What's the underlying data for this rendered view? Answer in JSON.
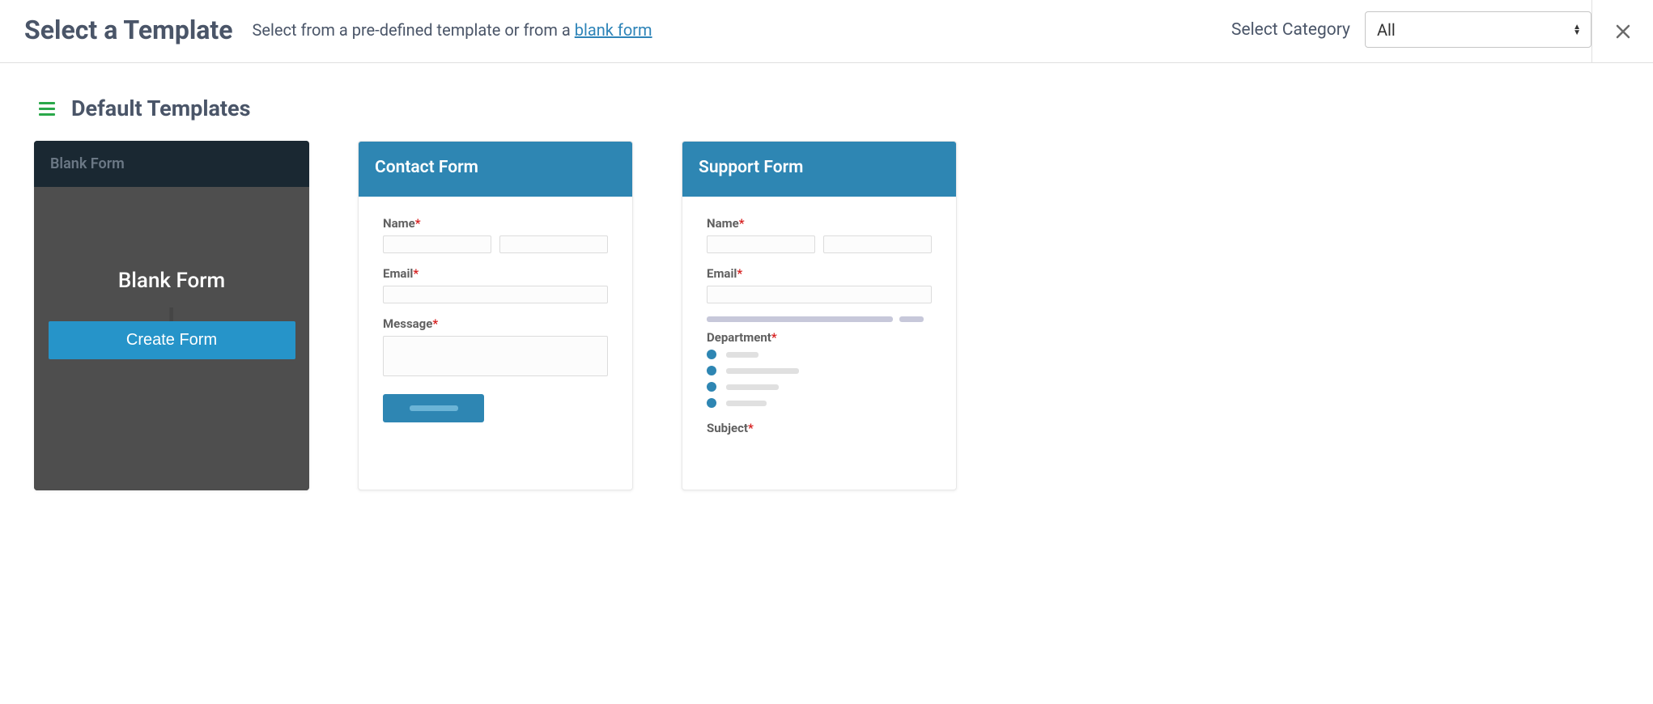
{
  "header": {
    "title": "Select a Template",
    "subtitle_prefix": "Select from a pre-defined template or from a ",
    "subtitle_link": "blank form",
    "category_label": "Select Category",
    "category_value": "All"
  },
  "section": {
    "title": "Default Templates"
  },
  "cards": {
    "blank": {
      "header": "Blank Form",
      "title": "Blank Form",
      "button": "Create Form"
    },
    "contact": {
      "title": "Contact Form",
      "fields": {
        "name": "Name",
        "email": "Email",
        "message": "Message"
      }
    },
    "support": {
      "title": "Support Form",
      "fields": {
        "name": "Name",
        "email": "Email",
        "department": "Department",
        "subject": "Subject"
      }
    }
  }
}
